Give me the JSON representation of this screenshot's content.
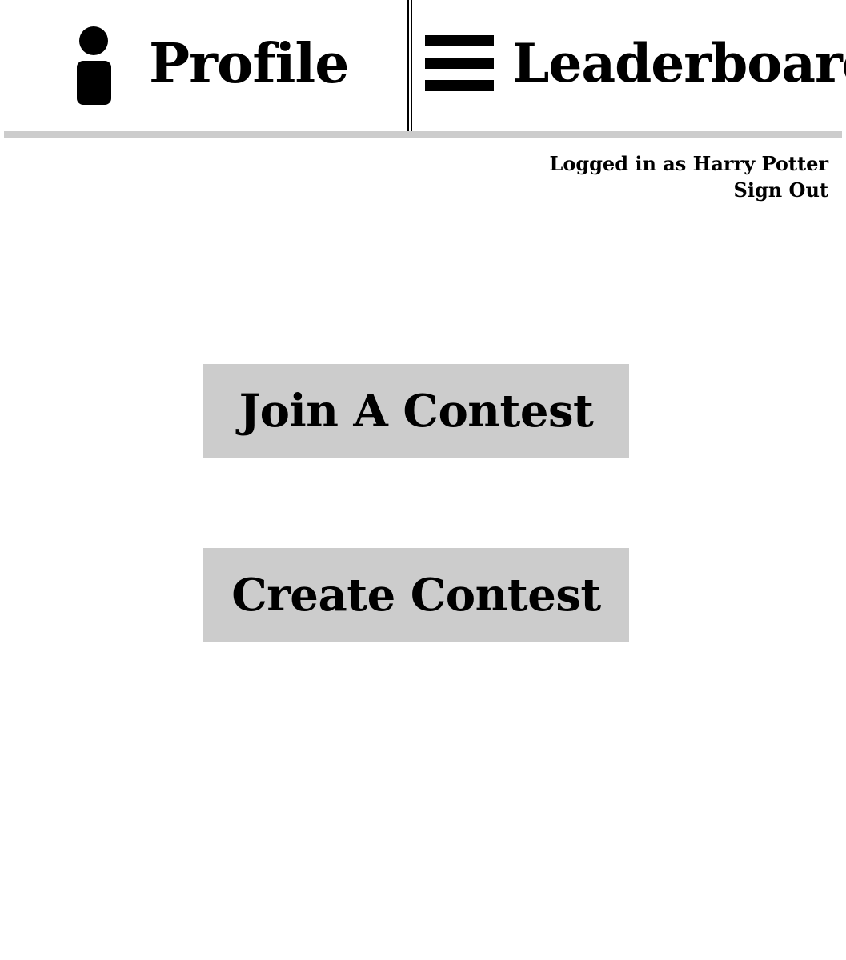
{
  "nav": {
    "profile": {
      "label": "Profile",
      "icon": "person-icon"
    },
    "leaderboard": {
      "label": "Leaderboard",
      "icon": "hamburger-menu-icon"
    }
  },
  "session": {
    "logged_in_text": "Logged in as Harry Potter",
    "sign_out_label": "Sign Out"
  },
  "actions": {
    "join_label": "Join A Contest",
    "create_label": "Create Contest"
  },
  "colors": {
    "button_background": "#cccccc",
    "nav_border": "#cccccc",
    "text": "#000000",
    "background": "#ffffff"
  }
}
